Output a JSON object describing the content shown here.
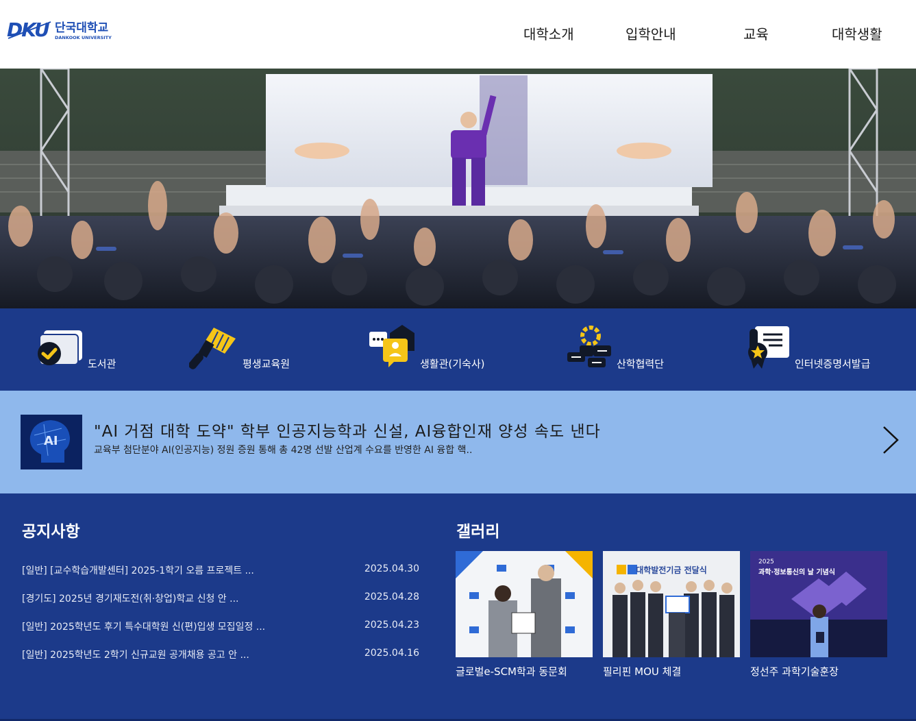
{
  "header": {
    "logo_text": "DKU 단국대학교",
    "logo_sub": "DANKOOK UNIVERSITY",
    "nav": [
      "대학소개",
      "입학안내",
      "교육",
      "대학생활"
    ]
  },
  "quick_links": [
    {
      "label": "도서관",
      "icon": "book-check-icon"
    },
    {
      "label": "평생교육원",
      "icon": "brush-icon"
    },
    {
      "label": "생활관(기숙사)",
      "icon": "dorm-house-icon"
    },
    {
      "label": "산학협력단",
      "icon": "industry-gear-icon"
    },
    {
      "label": "인터넷증명서발급",
      "icon": "certificate-icon"
    }
  ],
  "news": {
    "title": "\"AI 거점 대학 도약\" 학부 인공지능학과 신설, AI융합인재 양성 속도 낸다",
    "desc": "교육부 첨단분야 AI(인공지능) 정원 증원 통해 총 42명 선발 산업계 수요를 반영한 AI 융합 핵..",
    "thumb_text": "AI"
  },
  "notice": {
    "title": "공지사항",
    "items": [
      {
        "text": "[일반] [교수학습개발센터] 2025-1학기 오름 프로젝트 ...",
        "date": "2025.04.30"
      },
      {
        "text": "[경기도] 2025년 경기재도전(취·창업)학교 신청 안 ...",
        "date": "2025.04.28"
      },
      {
        "text": "[일반] 2025학년도 후기 특수대학원 신(편)입생 모집일정 ...",
        "date": "2025.04.23"
      },
      {
        "text": "[일반] 2025학년도 2학기 신규교원 공개채용 공고 안 ...",
        "date": "2025.04.16"
      }
    ]
  },
  "gallery": {
    "title": "갤러리",
    "items": [
      {
        "caption": "글로벌e-SCM학과 동문회"
      },
      {
        "caption": "필리핀 MOU 체결",
        "banner": "대학발전기금 전달식"
      },
      {
        "caption": "정선주 과학기술훈장",
        "banner": "과학·정보통신의 날 기념식",
        "year": "2025"
      }
    ]
  },
  "colors": {
    "navy": "#1c3a8a",
    "news_bg": "#8fb8ec",
    "icon_yellow": "#f5c518"
  }
}
